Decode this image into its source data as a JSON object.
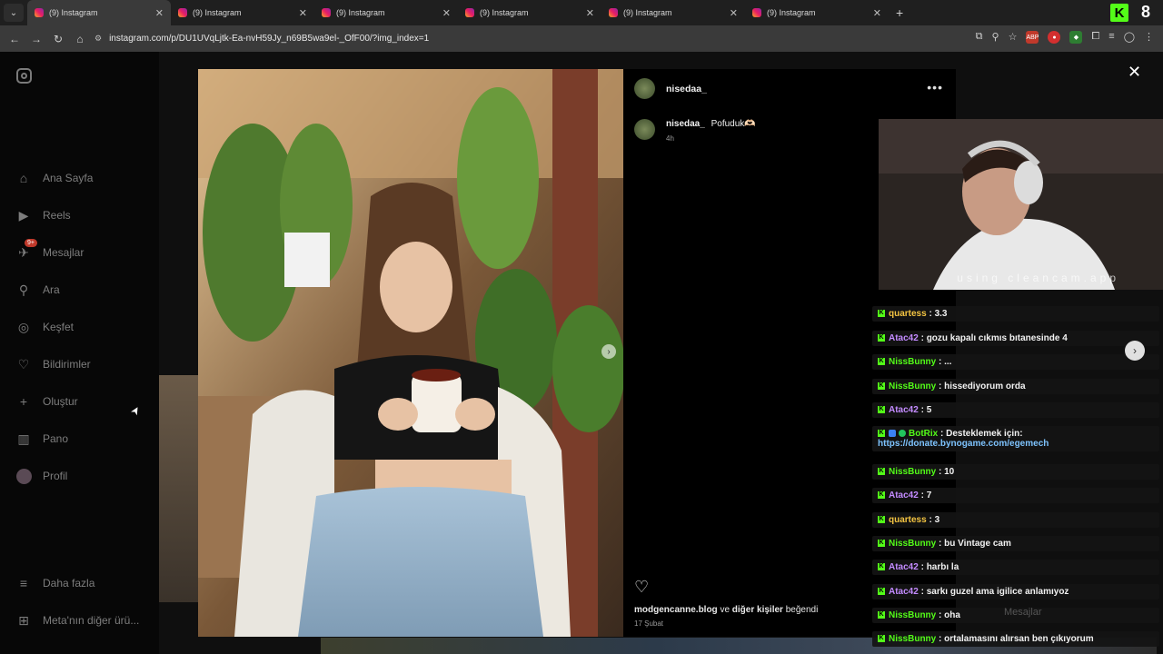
{
  "browser": {
    "tabs": [
      {
        "title": "(9) Instagram",
        "active": true
      },
      {
        "title": "(9) Instagram",
        "active": false
      },
      {
        "title": "(9) Instagram",
        "active": false
      },
      {
        "title": "(9) Instagram",
        "active": false
      },
      {
        "title": "(9) Instagram",
        "active": false
      },
      {
        "title": "(9) Instagram",
        "active": false
      }
    ],
    "new_tab": "+",
    "url": "instagram.com/p/DU1UVqLjtk-Ea-nvH59Jy_n69B5wa9el-_OfF00/?img_index=1",
    "kick_count": "8"
  },
  "sidebar": {
    "items": [
      {
        "label": "Ana Sayfa",
        "icon": "home-icon",
        "glyph": "⌂"
      },
      {
        "label": "Reels",
        "icon": "reels-icon",
        "glyph": "▶"
      },
      {
        "label": "Mesajlar",
        "icon": "messages-icon",
        "glyph": "✈",
        "badge": "9+"
      },
      {
        "label": "Ara",
        "icon": "search-icon",
        "glyph": "⚲"
      },
      {
        "label": "Keşfet",
        "icon": "explore-icon",
        "glyph": "◎"
      },
      {
        "label": "Bildirimler",
        "icon": "heart-icon",
        "glyph": "♡"
      },
      {
        "label": "Oluştur",
        "icon": "plus-icon",
        "glyph": "+"
      },
      {
        "label": "Pano",
        "icon": "dashboard-icon",
        "glyph": "▥"
      },
      {
        "label": "Profil",
        "icon": "avatar"
      }
    ],
    "more": {
      "label": "Daha fazla",
      "icon": "menu-icon",
      "glyph": "≡"
    },
    "meta": {
      "label": "Meta'nın diğer ürü...",
      "icon": "grid-icon",
      "glyph": "⊞"
    }
  },
  "post": {
    "username": "nisedaa_",
    "caption_user": "nisedaa_",
    "caption_text": "Pofuduk🫶🏻",
    "caption_time": "4h",
    "likes_users": "modgencanne.blog",
    "likes_connector": "ve",
    "likes_others": "diğer kişiler",
    "likes_suffix": "beğendi",
    "date": "17 Şubat"
  },
  "webcam": {
    "overlay_text": "using  cleancam.app"
  },
  "chat": {
    "messages": [
      {
        "user": "quartess",
        "color": "#f5c542",
        "text": "3.3"
      },
      {
        "user": "Atac42",
        "color": "#c38bff",
        "text": "gozu kapalı cıkmıs bıtanesinde 4"
      },
      {
        "user": "NissBunny",
        "color": "#53fc18",
        "text": "..."
      },
      {
        "user": "NissBunny",
        "color": "#53fc18",
        "text": "hissediyorum orda"
      },
      {
        "user": "Atac42",
        "color": "#c38bff",
        "text": "5"
      },
      {
        "user": "BotRix",
        "color": "#53fc18",
        "text": "Desteklemek için:",
        "link": "https://donate.bynogame.com/egemech"
      },
      {
        "user": "NissBunny",
        "color": "#53fc18",
        "text": "10"
      },
      {
        "user": "Atac42",
        "color": "#c38bff",
        "text": "7"
      },
      {
        "user": "quartess",
        "color": "#f5c542",
        "text": "3"
      },
      {
        "user": "NissBunny",
        "color": "#53fc18",
        "text": "bu Vintage cam"
      },
      {
        "user": "Atac42",
        "color": "#c38bff",
        "text": "harbı la"
      },
      {
        "user": "Atac42",
        "color": "#c38bff",
        "text": "sarkı guzel ama igilice anlamıyoz"
      },
      {
        "user": "NissBunny",
        "color": "#53fc18",
        "text": "oha"
      },
      {
        "user": "NissBunny",
        "color": "#53fc18",
        "text": "ortalamasını alırsan ben çıkıyorum"
      }
    ],
    "ghost_label": "Mesajlar"
  }
}
